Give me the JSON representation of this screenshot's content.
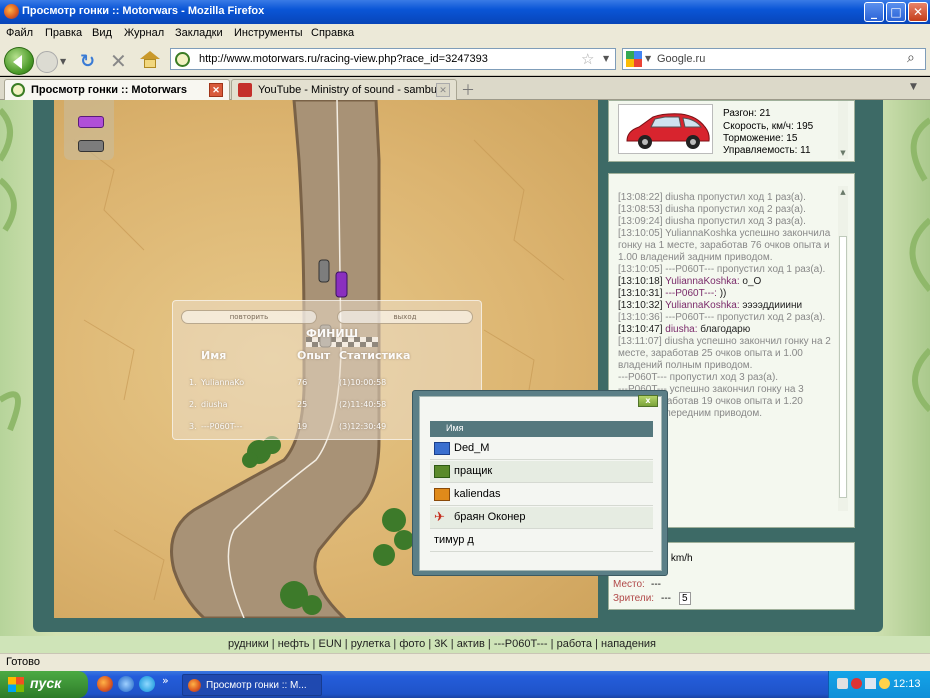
{
  "window": {
    "title": "Просмотр гонки :: Motorwars - Mozilla Firefox",
    "buttons": {
      "minimize": "_",
      "maximize": "□",
      "close": "✕"
    }
  },
  "menu": [
    "Файл",
    "Правка",
    "Вид",
    "Журнал",
    "Закладки",
    "Инструменты",
    "Справка"
  ],
  "nav": {
    "url": "http://www.motorwars.ru/racing-view.php?race_id=3247393",
    "search_text": "Google.ru",
    "icons": [
      "back-icon",
      "forward-icon",
      "reload-icon",
      "stop-icon",
      "home-icon",
      "bookmark-star-icon",
      "search-icon"
    ]
  },
  "tabs": [
    {
      "label": "Просмотр гонки :: Motorwars",
      "active": true
    },
    {
      "label": "YouTube - Ministry of sound - sambuca",
      "active": false
    }
  ],
  "finish_panel": {
    "repeat_button": "повторить",
    "exit_button": "выход",
    "title": "ФИНИШ",
    "col_name": "Имя",
    "col_exp": "Опыт",
    "col_stats": "Статистика",
    "rows": [
      {
        "pos": "1.",
        "name": "YuliannaKo",
        "exp": "76",
        "stats": "(1)10:00:58"
      },
      {
        "pos": "2.",
        "name": "diusha",
        "exp": "25",
        "stats": "(2)11:40:58"
      },
      {
        "pos": "3.",
        "name": "---P060T---",
        "exp": "19",
        "stats": "(3)12:30:49"
      }
    ]
  },
  "car_info": {
    "stats": [
      "Разгон: 21",
      "Скорость, км/ч: 195",
      "Торможение: 15",
      "Управляемость: 11"
    ]
  },
  "chat": {
    "messages": [
      {
        "time": "[13:08:22]",
        "nick": "",
        "text": "diusha пропустил ход 1 раз(а).",
        "type": "system"
      },
      {
        "time": "[13:08:53]",
        "nick": "",
        "text": "diusha пропустил ход 2 раз(а).",
        "type": "system"
      },
      {
        "time": "[13:09:24]",
        "nick": "",
        "text": "diusha пропустил ход 3 раз(а).",
        "type": "system"
      },
      {
        "time": "[13:10:05]",
        "nick": "",
        "text": "YuliannaKoshka успешно закончила гонку на 1 месте, заработав 76 очков опыта и 1.00 владений задним приводом.",
        "type": "system"
      },
      {
        "time": "[13:10:05]",
        "nick": "",
        "text": "---P060T--- пропустил ход 1 раз(а).",
        "type": "system"
      },
      {
        "time": "[13:10:18]",
        "nick": "YuliannaKoshka:",
        "text": "o_O",
        "type": "say"
      },
      {
        "time": "[13:10:31]",
        "nick": "---P060T---:",
        "text": "))",
        "type": "say"
      },
      {
        "time": "[13:10:32]",
        "nick": "YuliannaKoshka:",
        "text": "ээээддииини",
        "type": "say"
      },
      {
        "time": "[13:10:36]",
        "nick": "",
        "text": "---P060T--- пропустил ход 2 раз(а).",
        "type": "system"
      },
      {
        "time": "[13:10:47]",
        "nick": "diusha:",
        "text": "благодарю",
        "type": "say"
      },
      {
        "time": "[13:11:07]",
        "nick": "",
        "text": "diusha успешно закончил гонку на 2 месте, заработав 25 очков опыта и 1.00 владений полным приводом.",
        "type": "system"
      },
      {
        "time": "",
        "nick": "",
        "text": "---P060T--- пропустил ход 3 раз(а).",
        "type": "system"
      },
      {
        "time": "",
        "nick": "",
        "text": "---P060T--- успешно закончил гонку на 3 месте, заработав 19 очков опыта и 1.20 владений передним приводом.",
        "type": "system"
      }
    ]
  },
  "race_info": {
    "speed": "98 km/h",
    "place_label": "Место:",
    "place_value": "---",
    "spectators_label": "Зрители:",
    "spectators_value": "---",
    "spectators_count": "5"
  },
  "spectators": {
    "header": "Имя",
    "close": "x",
    "list": [
      "Ded_M",
      "пращик",
      "kaliendas",
      "браян Оконер",
      "тимур д"
    ]
  },
  "footer_links": [
    "рудники",
    "нефть",
    "EUN",
    "рулетка",
    "фото",
    "3K",
    "актив",
    "---P060T---",
    "работа",
    "нападения"
  ],
  "status": "Готово",
  "taskbar": {
    "start": "пуск",
    "item": "Просмотр гонки :: M...",
    "clock": "12:13",
    "overflow": "»"
  },
  "colors": {
    "frame": "#3d6a66",
    "chat_nick": "#7a2a6a",
    "titlebar": "#0a55d6"
  }
}
